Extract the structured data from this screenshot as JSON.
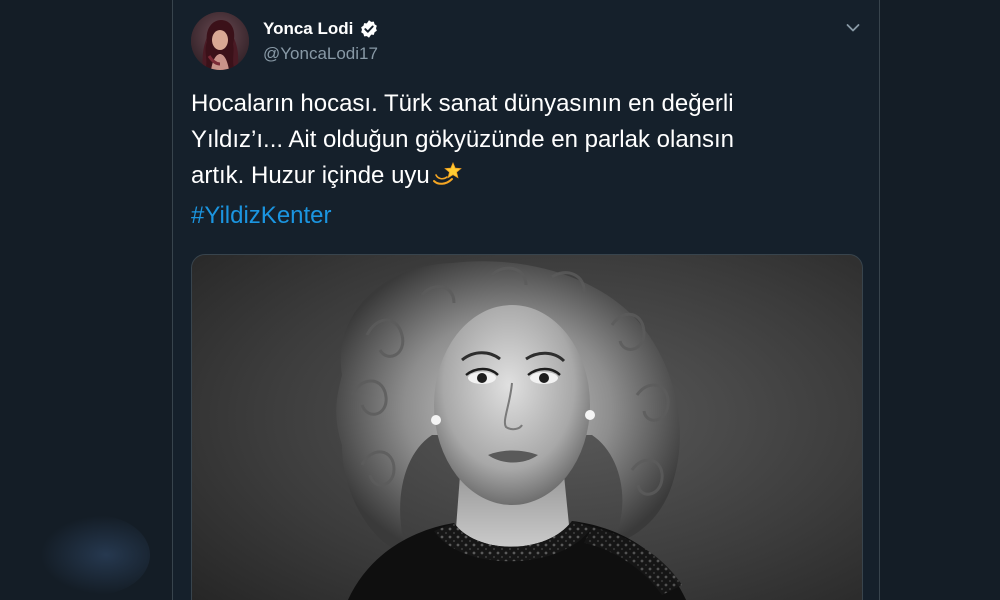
{
  "tweet": {
    "author_name": "Yonca Lodi",
    "handle": "@YoncaLodi17",
    "text_lines": [
      "Hocaların hocası. Türk sanat dünyasının en değerli",
      "Yıldız’ı... Ait olduğun gökyüzünde en parlak olansın",
      "artık. Huzur içinde uyu"
    ],
    "emoji": "dizzy-star-emoji",
    "hashtag": "#YildizKenter",
    "icons": {
      "verified": "verified-badge-icon",
      "more": "chevron-down-icon"
    }
  },
  "colors": {
    "background": "#141d26",
    "card": "#15202b",
    "border": "#38444d",
    "text": "#ffffff",
    "secondary": "#8899a6",
    "link": "#1b95e0",
    "verified": "#ffffff"
  }
}
